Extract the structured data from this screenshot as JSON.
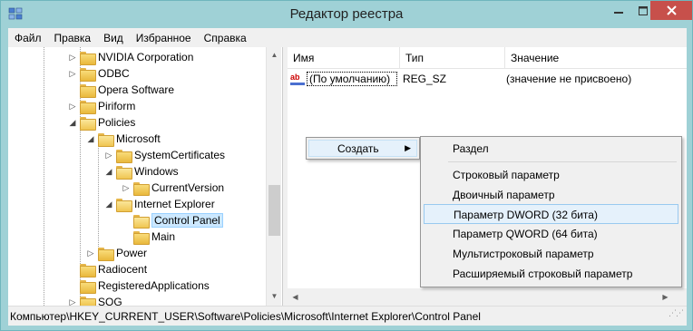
{
  "window": {
    "title": "Редактор реестра"
  },
  "menu": [
    "Файл",
    "Правка",
    "Вид",
    "Избранное",
    "Справка"
  ],
  "tree": {
    "items": [
      {
        "label": "NVIDIA Corporation",
        "expander": "▷"
      },
      {
        "label": "ODBC",
        "expander": "▷"
      },
      {
        "label": "Opera Software",
        "expander": ""
      },
      {
        "label": "Piriform",
        "expander": "▷"
      },
      {
        "label": "Policies",
        "expander": "◢"
      },
      {
        "label": "Microsoft",
        "expander": "◢"
      },
      {
        "label": "SystemCertificates",
        "expander": "▷"
      },
      {
        "label": "Windows",
        "expander": "◢"
      },
      {
        "label": "CurrentVersion",
        "expander": "▷"
      },
      {
        "label": "Internet Explorer",
        "expander": "◢"
      },
      {
        "label": "Control Panel",
        "expander": ""
      },
      {
        "label": "Main",
        "expander": ""
      },
      {
        "label": "Power",
        "expander": "▷"
      },
      {
        "label": "Radiocent",
        "expander": ""
      },
      {
        "label": "RegisteredApplications",
        "expander": ""
      },
      {
        "label": "SOG",
        "expander": "▷"
      }
    ]
  },
  "list": {
    "columns": [
      "Имя",
      "Тип",
      "Значение"
    ],
    "rows": [
      {
        "icon": "ab",
        "name": "(По умолчанию)",
        "type": "REG_SZ",
        "value": "(значение не присвоено)"
      }
    ]
  },
  "context_menu": {
    "create_label": "Создать",
    "submenu": [
      "Раздел",
      "Строковый параметр",
      "Двоичный параметр",
      "Параметр DWORD (32 бита)",
      "Параметр QWORD (64 бита)",
      "Мультистроковый параметр",
      "Расширяемый строковый параметр"
    ]
  },
  "status": {
    "path": "Компьютер\\HKEY_CURRENT_USER\\Software\\Policies\\Microsoft\\Internet Explorer\\Control Panel"
  },
  "icons": {
    "app": "regedit-icon",
    "folder": "folder-icon",
    "string_value": "string-value-icon",
    "minimize": "minimize-icon",
    "maximize": "maximize-icon",
    "close": "close-icon"
  },
  "colors": {
    "titlebar": "#9fd1d6",
    "close_button": "#c7504b",
    "selection": "#cce8ff",
    "menu_highlight": "#e5f1fb"
  }
}
